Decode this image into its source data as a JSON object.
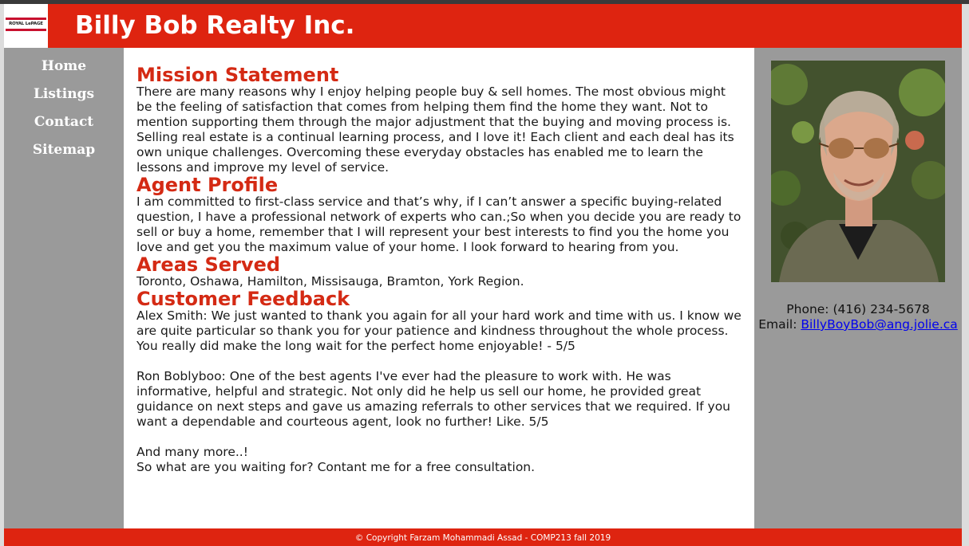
{
  "header": {
    "logo_text": "ROYAL LePAGE",
    "title": "Billy Bob Realty Inc."
  },
  "nav": {
    "items": [
      {
        "label": "Home"
      },
      {
        "label": "Listings"
      },
      {
        "label": "Contact"
      },
      {
        "label": "Sitemap"
      }
    ]
  },
  "main": {
    "mission": {
      "heading": "Mission Statement",
      "text": "There are many reasons why I enjoy helping people buy & sell homes. The most obvious might be the feeling of satisfaction that comes from helping them find the home they want. Not to mention supporting them through the major adjustment that the buying and moving process is. Selling real estate is a continual learning process, and I love it! Each client and each deal has its own unique challenges. Overcoming these everyday obstacles has enabled me to learn the lessons and improve my level of service."
    },
    "profile": {
      "heading": "Agent Profile",
      "text": "I am committed to first-class service and that’s why, if I can’t answer a specific buying-related question, I have a professional network of experts who can.;So when you decide you are ready to sell or buy a home, remember that I will represent your best interests to find you the home you love and get you the maximum value of your home. I look forward to hearing from you."
    },
    "areas": {
      "heading": "Areas Served",
      "text": "Toronto, Oshawa, Hamilton, Missisauga, Bramton, York Region."
    },
    "feedback": {
      "heading": "Customer Feedback",
      "review1": "Alex Smith: We just wanted to thank you again for all your hard work and time with us. I know we are quite particular so thank you for your patience and kindness throughout the whole process. You really did make the long wait for the perfect home enjoyable! - 5/5",
      "review2": "Ron Boblyboo: One of the best agents I've ever had the pleasure to work with. He was informative, helpful and strategic. Not only did he help us sell our home, he provided great guidance on next steps and gave us amazing referrals to other services that we required. If you want a dependable and courteous agent, look no further! Like. 5/5",
      "closing1": "And many more..!",
      "closing2": "So what are you waiting for? Contant me for a free consultation."
    }
  },
  "aside": {
    "phone": "Phone: (416) 234-5678",
    "email_label": "Email: ",
    "email": "BillyBoyBob@ang.jolie.ca"
  },
  "footer": {
    "text": "© Copyright Farzam Mohammadi Assad - COMP213 fall 2019"
  },
  "colors": {
    "brand_red": "#de2410",
    "heading_red": "#d42a14",
    "sidebar_gray": "#9a9a9a",
    "link_blue": "#0000ee"
  }
}
